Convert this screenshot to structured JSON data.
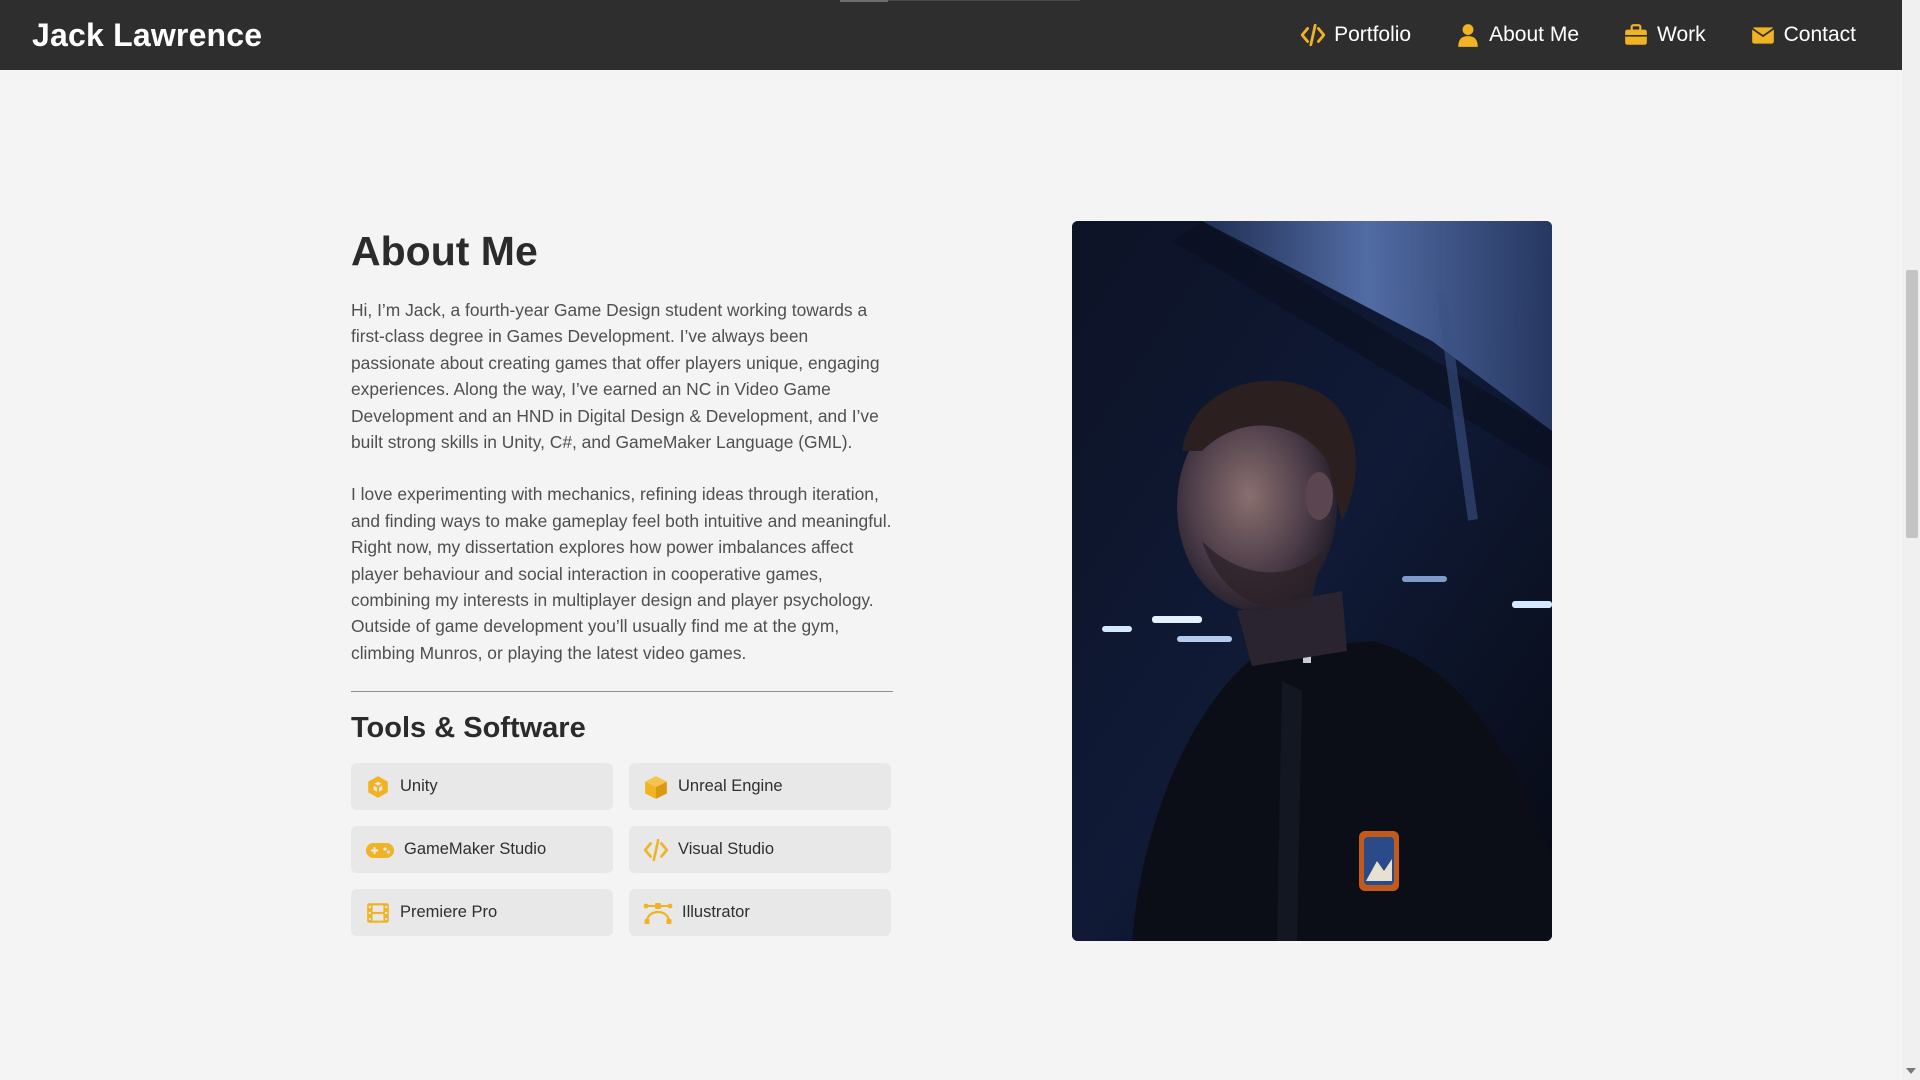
{
  "header": {
    "brand": "Jack Lawrence",
    "nav": [
      {
        "label": "Portfolio",
        "icon": "code-icon"
      },
      {
        "label": "About Me",
        "icon": "user-icon"
      },
      {
        "label": "Work",
        "icon": "briefcase-icon"
      },
      {
        "label": "Contact",
        "icon": "envelope-icon"
      }
    ]
  },
  "about": {
    "title": "About Me",
    "paragraphs": [
      "Hi, I’m Jack, a fourth-year Game Design student working towards a first-class degree in Games Development. I’ve always been passionate about creating games that offer players unique, engaging experiences. Along the way, I’ve earned an NC in Video Game Development and an HND in Digital Design & Development, and I’ve built strong skills in Unity, C#, and GameMaker Language (GML).",
      "I love experimenting with mechanics, refining ideas through iteration, and finding ways to make gameplay feel both intuitive and meaningful. Right now, my dissertation explores how power imbalances affect player behaviour and social interaction in cooperative games, combining my interests in multiplayer design and player psychology. Outside of game development you’ll usually find me at the gym, climbing Munros, or playing the latest video games."
    ]
  },
  "tools": {
    "title": "Tools & Software",
    "items": [
      {
        "label": "Unity",
        "icon": "unity-icon"
      },
      {
        "label": "Unreal Engine",
        "icon": "cube-icon"
      },
      {
        "label": "GameMaker Studio",
        "icon": "gamepad-icon"
      },
      {
        "label": "Visual Studio",
        "icon": "code-icon"
      },
      {
        "label": "Premiere Pro",
        "icon": "film-icon"
      },
      {
        "label": "Illustrator",
        "icon": "bezier-icon"
      }
    ]
  },
  "colors": {
    "accent": "#f0b323",
    "header_bg": "#2e2e2e",
    "page_bg": "#f4f4f4",
    "tool_bg": "#e8e8e8"
  }
}
